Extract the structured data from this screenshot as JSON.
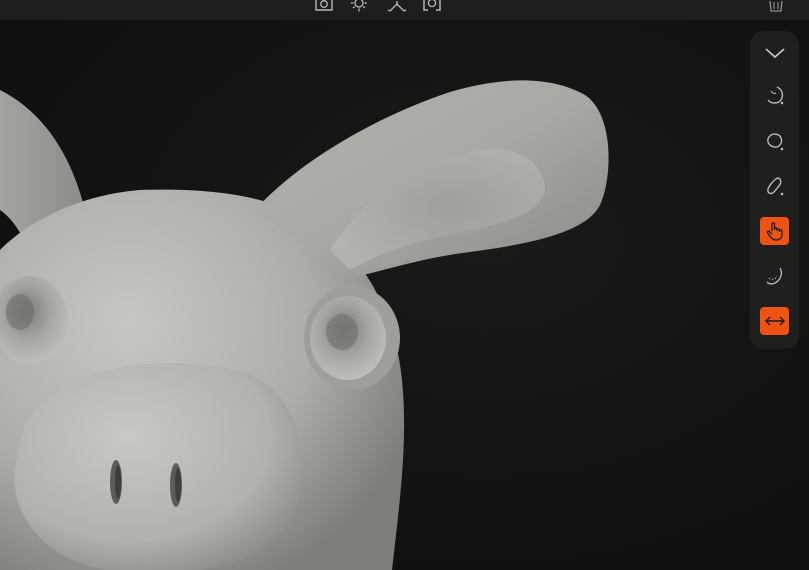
{
  "colors": {
    "accent": "#ee5314",
    "panel_bg": "#1f1f1e",
    "viewport_bg": "#121210",
    "icon": "#b9b9b4",
    "model": "#b7b6b1"
  },
  "top_toolbar": {
    "icons": [
      "camera-icon",
      "light-icon",
      "symmetry-icon",
      "view-focus-icon",
      "trash-icon"
    ]
  },
  "sculpt_panel": {
    "tools": [
      {
        "icon": "chevron-down-icon",
        "active": false
      },
      {
        "icon": "smooth-brush-icon",
        "active": false
      },
      {
        "icon": "inflate-brush-icon",
        "active": false
      },
      {
        "icon": "clay-brush-icon",
        "active": false
      },
      {
        "icon": "move-hand-icon",
        "active": true
      },
      {
        "icon": "flatten-brush-icon",
        "active": false
      },
      {
        "icon": "stretch-arrows-icon",
        "active": true
      }
    ]
  }
}
